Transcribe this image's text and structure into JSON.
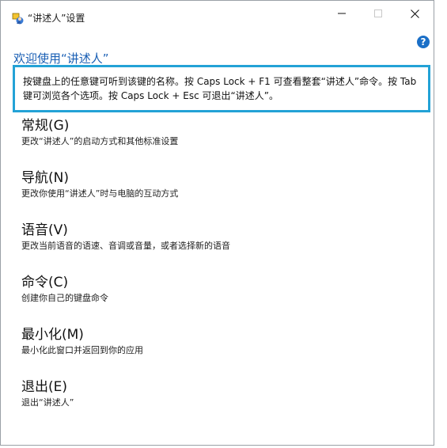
{
  "window": {
    "title": "“讲述人”设置"
  },
  "controls": {
    "help_label": "?"
  },
  "welcome": "欢迎使用“讲述人”",
  "info": {
    "line1": "按键盘上的任意键可听到该键的名称。按 Caps Lock + F1 可查看整套“讲述人”命令。按 Tab",
    "line2": "键可浏览各个选项。按 Caps Lock + Esc 可退出“讲述人”。"
  },
  "options": [
    {
      "title": "常规(G)",
      "desc": "更改“讲述人”的启动方式和其他标准设置"
    },
    {
      "title": "导航(N)",
      "desc": "更改你使用“讲述人”时与电脑的互动方式"
    },
    {
      "title": "语音(V)",
      "desc": "更改当前语音的语速、音调或音量，或者选择新的语音"
    },
    {
      "title": "命令(C)",
      "desc": "创建你自己的键盘命令"
    },
    {
      "title": "最小化(M)",
      "desc": "最小化此窗口并返回到你的应用"
    },
    {
      "title": "退出(E)",
      "desc": "退出“讲述人”"
    }
  ],
  "colors": {
    "accent": "#1a5fb4",
    "info_border": "#23a2d6",
    "help_bg": "#1a6fc7"
  },
  "icons": {
    "app": "narrator-icon",
    "minimize": "minimize-icon",
    "maximize": "maximize-icon",
    "close": "close-icon",
    "help": "help-icon"
  }
}
